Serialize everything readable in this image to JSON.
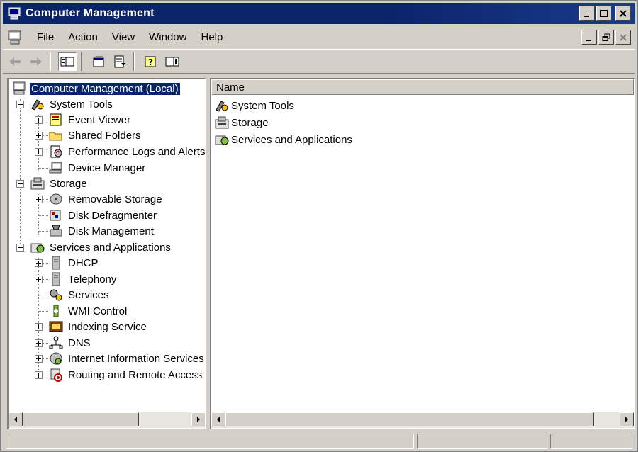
{
  "window": {
    "title": "Computer Management",
    "controls": [
      "minimize",
      "maximize",
      "close"
    ]
  },
  "menu": {
    "items": [
      {
        "label": "File"
      },
      {
        "label": "Action"
      },
      {
        "label": "View"
      },
      {
        "label": "Window"
      },
      {
        "label": "Help"
      }
    ]
  },
  "toolbar": {
    "buttons": [
      "back-icon",
      "forward-icon",
      "show-hide-tree-icon",
      "properties-icon",
      "export-list-icon",
      "help-icon",
      "show-hide-action-pane-icon"
    ]
  },
  "tree": {
    "root": "Computer Management (Local)",
    "system_tools": "System Tools",
    "event_viewer": "Event Viewer",
    "shared_folders": "Shared Folders",
    "perf_logs": "Performance Logs and Alerts",
    "device_manager": "Device Manager",
    "storage": "Storage",
    "removable_storage": "Removable Storage",
    "disk_defrag": "Disk Defragmenter",
    "disk_management": "Disk Management",
    "services_apps": "Services and Applications",
    "dhcp": "DHCP",
    "telephony": "Telephony",
    "services": "Services",
    "wmi": "WMI Control",
    "indexing": "Indexing Service",
    "dns": "DNS",
    "iis": "Internet Information Services",
    "routing": "Routing and Remote Access"
  },
  "list": {
    "column_name": "Name",
    "items": [
      {
        "label": "System Tools"
      },
      {
        "label": "Storage"
      },
      {
        "label": "Services and Applications"
      }
    ]
  },
  "colors": {
    "titlebar": "#0a246a",
    "face": "#d4d0c8",
    "selection": "#0a246a"
  }
}
